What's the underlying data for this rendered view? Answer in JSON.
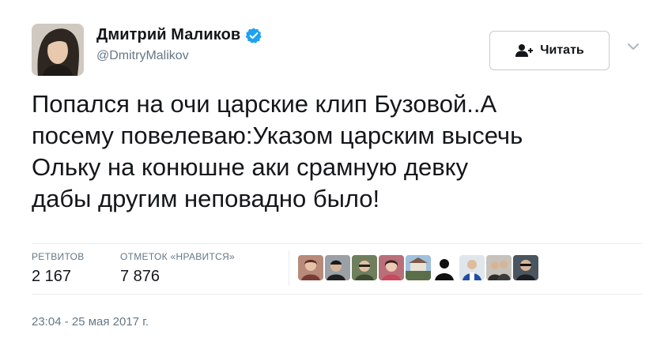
{
  "user": {
    "display_name": "Дмитрий Маликов",
    "handle": "@DmitryMalikov",
    "verified_icon": "verified-badge-icon",
    "verified_color": "#1da1f2"
  },
  "follow_button": {
    "label": "Читать",
    "icon": "follow-person-icon"
  },
  "tweet": {
    "lines": [
      "Попался на очи царские клип Бузовой..А",
      "посему повелеваю:Указом царским высечь",
      "Ольку на конюшне аки срамную девку",
      "дабы другим неповадно было!"
    ]
  },
  "stats": {
    "retweets_label": "РЕТВИТОВ",
    "retweets_value": "2 167",
    "likes_label": "ОТМЕТОК «НРАВИТСЯ»",
    "likes_value": "7 876"
  },
  "timestamp": "23:04 - 25 мая 2017 г.",
  "colors": {
    "text": "#14171a",
    "secondary": "#657786",
    "divider": "#e6ecf0",
    "button_border": "#c5ccd2"
  }
}
